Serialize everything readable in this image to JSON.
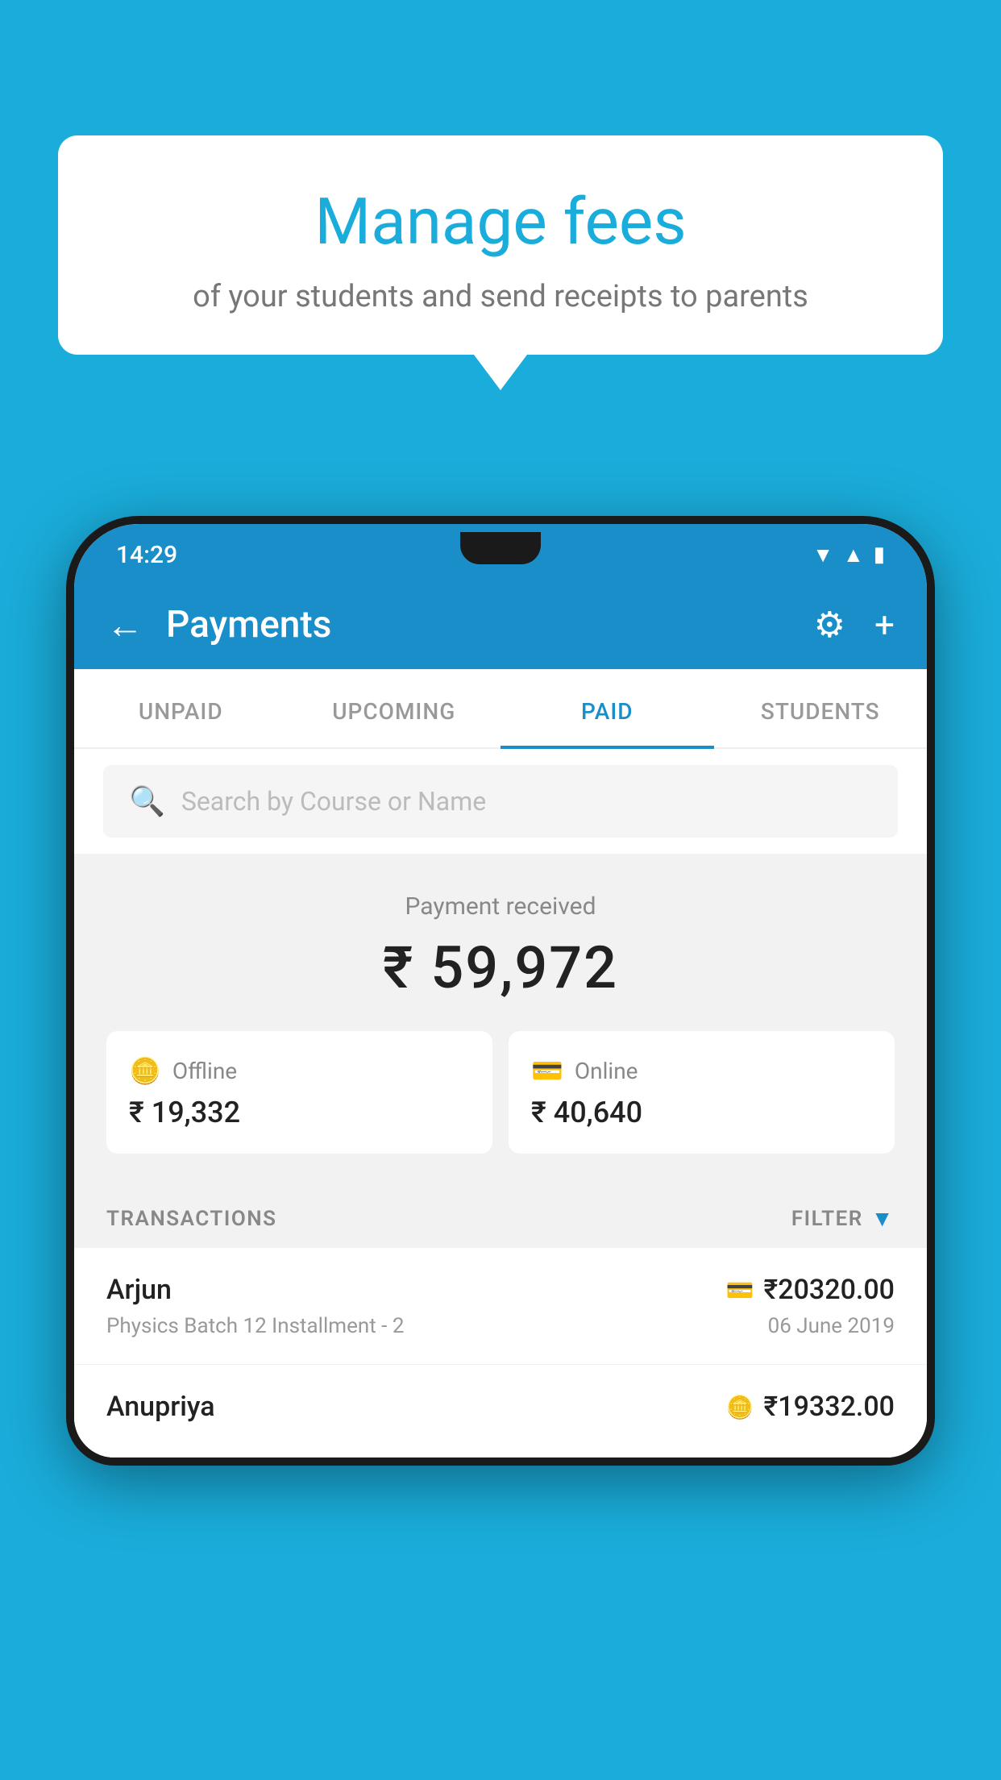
{
  "background_color": "#1AADDB",
  "tooltip": {
    "title": "Manage fees",
    "subtitle": "of your students and send receipts to parents"
  },
  "status_bar": {
    "time": "14:29",
    "icons": [
      "wifi",
      "signal",
      "battery"
    ]
  },
  "app_bar": {
    "title": "Payments",
    "back_label": "←",
    "settings_label": "⚙",
    "add_label": "+"
  },
  "tabs": [
    {
      "label": "UNPAID",
      "active": false
    },
    {
      "label": "UPCOMING",
      "active": false
    },
    {
      "label": "PAID",
      "active": true
    },
    {
      "label": "STUDENTS",
      "active": false
    }
  ],
  "search": {
    "placeholder": "Search by Course or Name"
  },
  "payment_received": {
    "label": "Payment received",
    "amount": "₹ 59,972"
  },
  "payment_methods": [
    {
      "type": "Offline",
      "amount": "₹ 19,332",
      "icon": "💳"
    },
    {
      "type": "Online",
      "amount": "₹ 40,640",
      "icon": "💳"
    }
  ],
  "transactions_section": {
    "label": "TRANSACTIONS",
    "filter_label": "FILTER"
  },
  "transactions": [
    {
      "name": "Arjun",
      "detail": "Physics Batch 12 Installment - 2",
      "amount": "₹20320.00",
      "date": "06 June 2019",
      "icon": "card"
    },
    {
      "name": "Anupriya",
      "detail": "",
      "amount": "₹19332.00",
      "date": "",
      "icon": "cash"
    }
  ]
}
